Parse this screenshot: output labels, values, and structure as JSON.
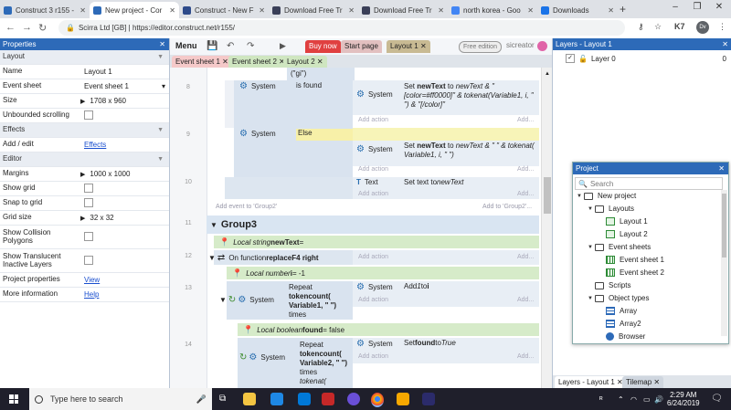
{
  "browser": {
    "tabs": [
      {
        "title": "Construct 3 r155 -",
        "color": "#2d6ab8"
      },
      {
        "title": "New project - Cor",
        "color": "#2d6ab8"
      },
      {
        "title": "Construct - New F",
        "color": "#2d4a8a"
      },
      {
        "title": "Download Free Tr",
        "color": "#3a3f58"
      },
      {
        "title": "Download Free Tr",
        "color": "#3a3f58"
      },
      {
        "title": "north korea - Goo",
        "color": "#4285f4"
      },
      {
        "title": "Downloads",
        "color": "#1a73e8"
      }
    ],
    "new_tab": "+",
    "url": "Scirra Ltd [GB] | https://editor.construct.net/r155/",
    "avatar": "Dv",
    "ext_label": "K7"
  },
  "properties": {
    "title": "Properties",
    "rows": [
      {
        "type": "section",
        "name": "Layout"
      },
      {
        "type": "text",
        "name": "Name",
        "value": "Layout 1"
      },
      {
        "type": "select",
        "name": "Event sheet",
        "value": "Event sheet 1"
      },
      {
        "type": "expand",
        "name": "Size",
        "value": "1708 x 960"
      },
      {
        "type": "check",
        "name": "Unbounded scrolling"
      },
      {
        "type": "section",
        "name": "Effects"
      },
      {
        "type": "link",
        "name": "Add / edit",
        "value": "Effects"
      },
      {
        "type": "section",
        "name": "Editor"
      },
      {
        "type": "expand",
        "name": "Margins",
        "value": "1000 x 1000"
      },
      {
        "type": "check",
        "name": "Show grid"
      },
      {
        "type": "check",
        "name": "Snap to grid"
      },
      {
        "type": "expand",
        "name": "Grid size",
        "value": "32 x 32"
      },
      {
        "type": "check2",
        "name": "Show Collision Polygons"
      },
      {
        "type": "check2",
        "name": "Show Translucent Inactive Layers"
      },
      {
        "type": "link",
        "name": "Project properties",
        "value": "View"
      },
      {
        "type": "link",
        "name": "More information",
        "value": "Help"
      }
    ]
  },
  "menubar": {
    "menu": "Menu",
    "buy_now": "Buy now",
    "start_page": "Start page",
    "layout1": "Layout 1",
    "edition": "Free edition",
    "user": "sicreator"
  },
  "doc_tabs": [
    "Event sheet 1",
    "Event sheet 2",
    "Layout 2"
  ],
  "sheet": {
    "code_top": "(\"gi\")",
    "ev8": {
      "num": "8",
      "obj": "System",
      "cond": "is found",
      "act_obj": "System",
      "act_prefix": "Set ",
      "act_var": "newText",
      "act_to": " to ",
      "act_expr": "newText & \"[color=#ff0000]\" & tokenat(Variable1, i, \" \") & \"[/color]\""
    },
    "ev9": {
      "num": "9",
      "obj": "System",
      "cond": "Else",
      "act_obj": "System",
      "act_prefix": "Set ",
      "act_var": "newText",
      "act_to": " to ",
      "act_expr": "newText & \" \" & tokenat( Variable1, i, \" \")"
    },
    "ev10": {
      "num": "10",
      "act_obj": "Text",
      "act_text": "Set text to ",
      "act_var": "newText"
    },
    "add_action": "Add action",
    "add_dots": "Add...",
    "add_event_group2": "Add event to 'Group2'",
    "add_to_group2": "Add to 'Group2'...",
    "group3": {
      "num": "11",
      "name": "Group3"
    },
    "local_string": {
      "kw": "Local string ",
      "name": "newText",
      "rest": " ="
    },
    "ev12": {
      "num": "12",
      "kw": "On function ",
      "name": "replaceF4 right"
    },
    "local_number": {
      "kw": "Local number ",
      "name": "i",
      "rest": " = -1"
    },
    "ev13": {
      "num": "13",
      "obj": "System",
      "line1": "Repeat",
      "line2": "tokencount(",
      "line3": "Variable1, \" \")",
      "line4": "times",
      "act_obj": "System",
      "act_text": "Add ",
      "act_val": "1",
      "act_to": " to ",
      "act_var": "i"
    },
    "local_bool": {
      "kw": "Local boolean ",
      "name": "found",
      "rest": " = false"
    },
    "ev14": {
      "num": "14",
      "obj": "System",
      "line1": "Repeat",
      "line2": "tokencount(",
      "line3": "Variable2, \" \")",
      "line4": "times",
      "line5": "tokenat(",
      "act_obj": "System",
      "act_text": "Set ",
      "act_var": "found",
      "act_to": " to ",
      "act_val": "True"
    }
  },
  "layers": {
    "title": "Layers - Layout 1",
    "layer": "Layer 0",
    "count": "0",
    "bottom_tabs": [
      "Layers - Layout 1",
      "Tilemap"
    ]
  },
  "project": {
    "title": "Project",
    "search": "Search",
    "tree": [
      {
        "label": "New project",
        "icon": "folder",
        "depth": 0,
        "open": true
      },
      {
        "label": "Layouts",
        "icon": "folder",
        "depth": 1,
        "open": true
      },
      {
        "label": "Layout 1",
        "icon": "layout",
        "depth": 2
      },
      {
        "label": "Layout 2",
        "icon": "layout",
        "depth": 2
      },
      {
        "label": "Event sheets",
        "icon": "folder",
        "depth": 1,
        "open": true
      },
      {
        "label": "Event sheet 1",
        "icon": "eventsheet",
        "depth": 2
      },
      {
        "label": "Event sheet 2",
        "icon": "eventsheet",
        "depth": 2
      },
      {
        "label": "Scripts",
        "icon": "folder",
        "depth": 1
      },
      {
        "label": "Object types",
        "icon": "folder",
        "depth": 1,
        "open": true
      },
      {
        "label": "Array",
        "icon": "array",
        "depth": 2
      },
      {
        "label": "Array2",
        "icon": "array",
        "depth": 2
      },
      {
        "label": "Browser",
        "icon": "browser",
        "depth": 2
      }
    ]
  },
  "taskbar": {
    "search": "Type here to search",
    "time": "2:29 AM",
    "date": "6/24/2019"
  }
}
